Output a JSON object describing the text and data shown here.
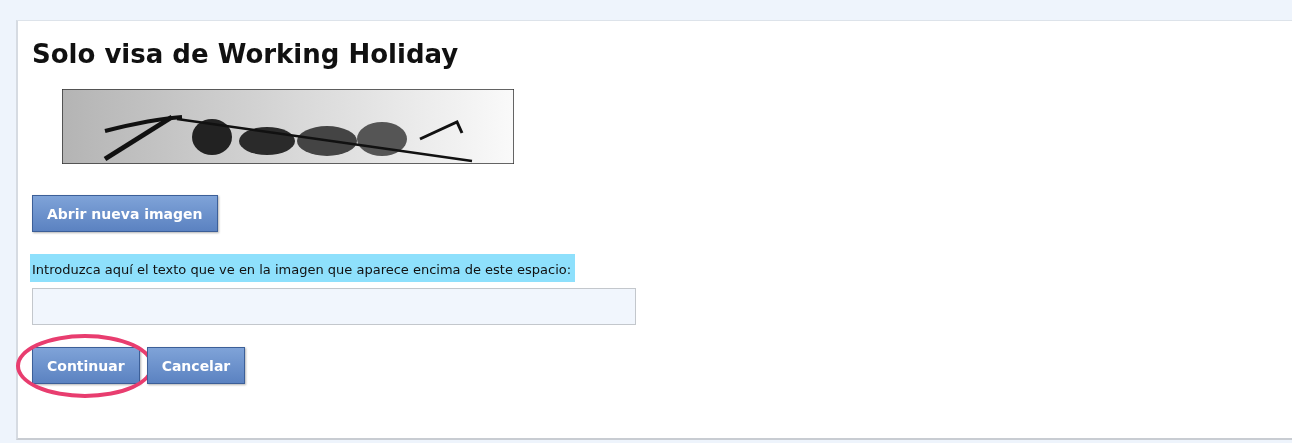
{
  "title": "Solo visa de Working Holiday",
  "refresh_button": {
    "label": "Abrir nueva imagen"
  },
  "captcha_field": {
    "label": "Introduzca aquí el texto que ve en la imagen que aparece encima de este espacio:"
  },
  "buttons": [
    {
      "label": "Continuar",
      "highlighted": true
    },
    {
      "label": "Cancelar",
      "highlighted": false
    }
  ]
}
